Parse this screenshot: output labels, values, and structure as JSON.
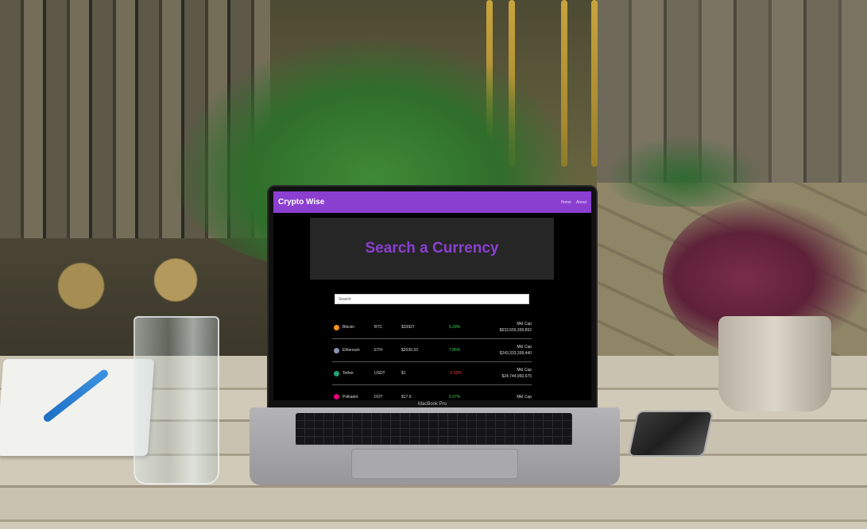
{
  "app": {
    "brand": "Crypto Wise",
    "nav": [
      "Home",
      "About"
    ]
  },
  "hero": {
    "title": "Search a Currency"
  },
  "search": {
    "placeholder": "Search"
  },
  "coins": [
    {
      "name": "Bitcoin",
      "symbol": "BTC",
      "price": "$33927",
      "change": "6.28%",
      "change_color": "#39d353",
      "mcap_label": "Mkt Cap",
      "mcap": "$633,559,399,892",
      "icon_color": "#f7931a"
    },
    {
      "name": "Ethereum",
      "symbol": "ETH",
      "price": "$2030.33",
      "change": "7.85%",
      "change_color": "#39d353",
      "mcap_label": "Mkt Cap",
      "mcap": "$243,333,399,440",
      "icon_color": "#8a92b2"
    },
    {
      "name": "Tether",
      "symbol": "USDT",
      "price": "$1",
      "change": "-0.03%",
      "change_color": "#ff3b3b",
      "mcap_label": "Mkt Cap",
      "mcap": "$24,744,960,675",
      "icon_color": "#26a17b"
    },
    {
      "name": "Polkadot",
      "symbol": "DOT",
      "price": "$17.9",
      "change": "6.97%",
      "change_color": "#39d353",
      "mcap_label": "Mkt Cap",
      "mcap": "",
      "icon_color": "#e6007a"
    }
  ],
  "device": {
    "model_label": "MacBook Pro"
  },
  "colors": {
    "accent": "#8b3fd1",
    "hero_bg": "#262626",
    "screen_bg": "#000000"
  }
}
